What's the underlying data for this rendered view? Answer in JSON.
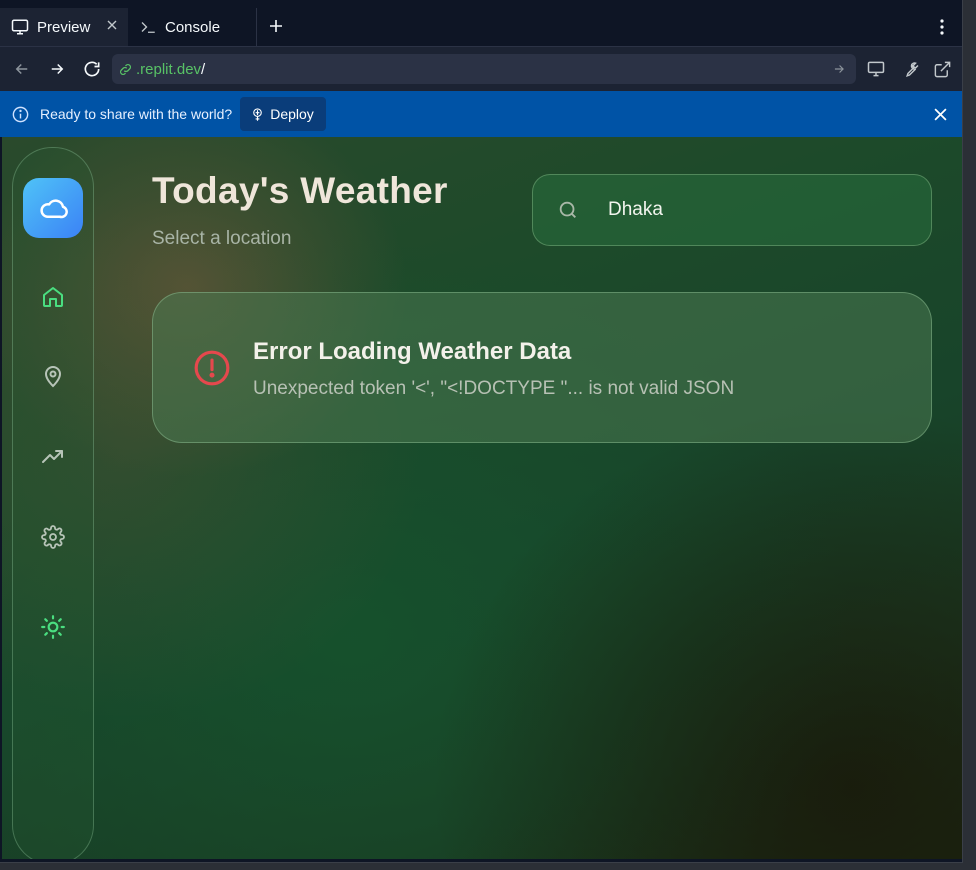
{
  "tabs": [
    {
      "label": "Preview",
      "icon": "monitor-icon"
    },
    {
      "label": "Console",
      "icon": "terminal-icon"
    }
  ],
  "urlbar": {
    "host": ".replit.dev",
    "path": "/"
  },
  "banner": {
    "message": "Ready to share with the world?",
    "deploy_label": "Deploy"
  },
  "app": {
    "title": "Today's Weather",
    "subtitle": "Select a location",
    "search": {
      "value": "Dhaka"
    },
    "error": {
      "title": "Error Loading Weather Data",
      "message": "Unexpected token '<', \"<!DOCTYPE \"... is not valid JSON"
    },
    "nav": [
      "home-icon",
      "map-pin-icon",
      "trending-up-icon",
      "gear-icon",
      "sun-icon"
    ]
  },
  "colors": {
    "accent_green": "#4ade80",
    "error_red": "#e5484d",
    "banner_blue": "#0053a6",
    "logo_blue": "#3b82f6"
  }
}
